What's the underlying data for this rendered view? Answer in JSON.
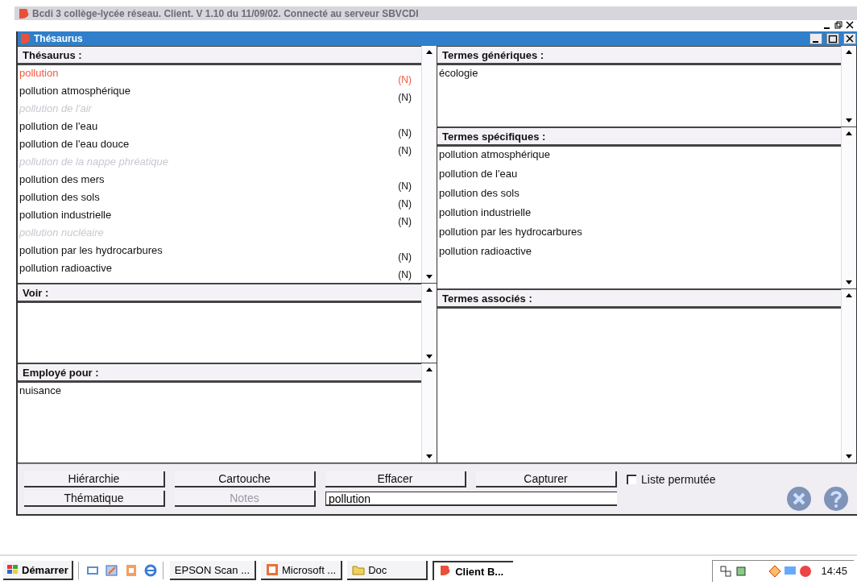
{
  "app_window": {
    "title": "Bcdi 3 collège-lycée réseau. Client. V 1.10 du 11/09/02. Connecté au serveur SBVCDI",
    "active": false
  },
  "thesaurus_window": {
    "title": "Thésaurus",
    "active": true
  },
  "thesaurus": {
    "heading": "Thésaurus :",
    "items": [
      {
        "text": "pollution",
        "kind": "current",
        "tag": "(N)"
      },
      {
        "text": "pollution atmosphérique",
        "kind": "descriptor",
        "tag": "(N)"
      },
      {
        "text": "pollution de l'air",
        "kind": "non_descriptor"
      },
      {
        "text": "pollution de l'eau",
        "kind": "descriptor",
        "tag": "(N)"
      },
      {
        "text": "pollution de l'eau douce",
        "kind": "descriptor",
        "tag": "(N)"
      },
      {
        "text": "pollution de la nappe phréatique",
        "kind": "non_descriptor"
      },
      {
        "text": "pollution des mers",
        "kind": "descriptor",
        "tag": "(N)"
      },
      {
        "text": "pollution des sols",
        "kind": "descriptor",
        "tag": "(N)"
      },
      {
        "text": "pollution industrielle",
        "kind": "descriptor",
        "tag": "(N)"
      },
      {
        "text": "pollution nucléaire",
        "kind": "non_descriptor"
      },
      {
        "text": "pollution par les hydrocarbures",
        "kind": "descriptor",
        "tag": "(N)"
      },
      {
        "text": "pollution radioactive",
        "kind": "descriptor",
        "tag": "(N)"
      }
    ]
  },
  "voir": {
    "heading": "Voir :"
  },
  "employe_pour": {
    "heading": "Employé pour :",
    "items": [
      "nuisance"
    ]
  },
  "termes_generiques": {
    "heading": "Termes génériques :",
    "items": [
      "écologie"
    ]
  },
  "termes_specifiques": {
    "heading": "Termes spécifiques :",
    "items": [
      "pollution atmosphérique",
      "pollution de l'eau",
      "pollution des sols",
      "pollution industrielle",
      "pollution par les hydrocarbures",
      "pollution radioactive"
    ]
  },
  "termes_associes": {
    "heading": "Termes associés :"
  },
  "buttons": [
    {
      "label": "Hiérarchie",
      "disabled": false
    },
    {
      "label": "Cartouche",
      "disabled": false
    },
    {
      "label": "Effacer",
      "disabled": false
    },
    {
      "label": "Capturer",
      "disabled": false
    },
    {
      "label": "Thématique",
      "disabled": false
    },
    {
      "label": "Notes",
      "disabled": true
    }
  ],
  "liste_permutee": {
    "label": "Liste permutée",
    "checked": false
  },
  "search": {
    "value": "pollution"
  },
  "taskbar": {
    "start": "Démarrer",
    "tasks": [
      {
        "label": "EPSON Scan ...",
        "kind": "plain",
        "selected": false
      },
      {
        "label": "Microsoft ...",
        "kind": "slides",
        "selected": false
      },
      {
        "label": "Doc",
        "kind": "folder",
        "selected": false
      },
      {
        "label": "Client B...",
        "kind": "app",
        "selected": true
      }
    ],
    "clock": "14:45"
  }
}
